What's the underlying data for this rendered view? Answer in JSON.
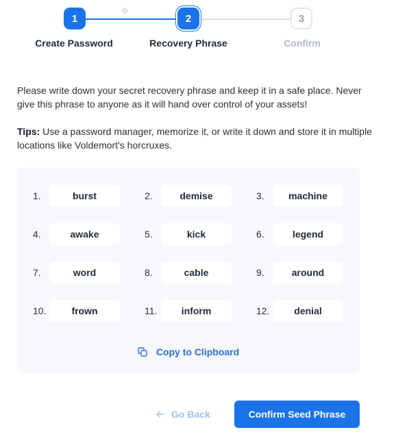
{
  "stepper": {
    "steps": [
      {
        "number": "1",
        "label": "Create Password",
        "state": "completed"
      },
      {
        "number": "2",
        "label": "Recovery Phrase",
        "state": "active"
      },
      {
        "number": "3",
        "label": "Confirm",
        "state": "pending"
      }
    ]
  },
  "instructions": {
    "text": "Please write down your secret recovery phrase and keep it in a safe place. Never give this phrase to anyone as it will hand over control of your assets!",
    "tips_label": "Tips:",
    "tips_text": " Use a password manager, memorize it, or write it down and store it in multiple locations like Voldemort's horcruxes."
  },
  "phrase": {
    "words": [
      {
        "index": "1.",
        "word": "burst"
      },
      {
        "index": "2.",
        "word": "demise"
      },
      {
        "index": "3.",
        "word": "machine"
      },
      {
        "index": "4.",
        "word": "awake"
      },
      {
        "index": "5.",
        "word": "kick"
      },
      {
        "index": "6.",
        "word": "legend"
      },
      {
        "index": "7.",
        "word": "word"
      },
      {
        "index": "8.",
        "word": "cable"
      },
      {
        "index": "9.",
        "word": "around"
      },
      {
        "index": "10.",
        "word": "frown"
      },
      {
        "index": "11.",
        "word": "inform"
      },
      {
        "index": "12.",
        "word": "denial"
      }
    ],
    "copy_label": "Copy to Clipboard",
    "copy_icon": "copy-icon"
  },
  "footer": {
    "back_label": "Go Back",
    "back_icon": "arrow-left-icon",
    "confirm_label": "Confirm Seed Phrase"
  },
  "colors": {
    "accent": "#1a73e8",
    "link": "#2a6fd6",
    "disabled_link": "#9fbff0",
    "panel_bg": "#f6f8fb"
  }
}
